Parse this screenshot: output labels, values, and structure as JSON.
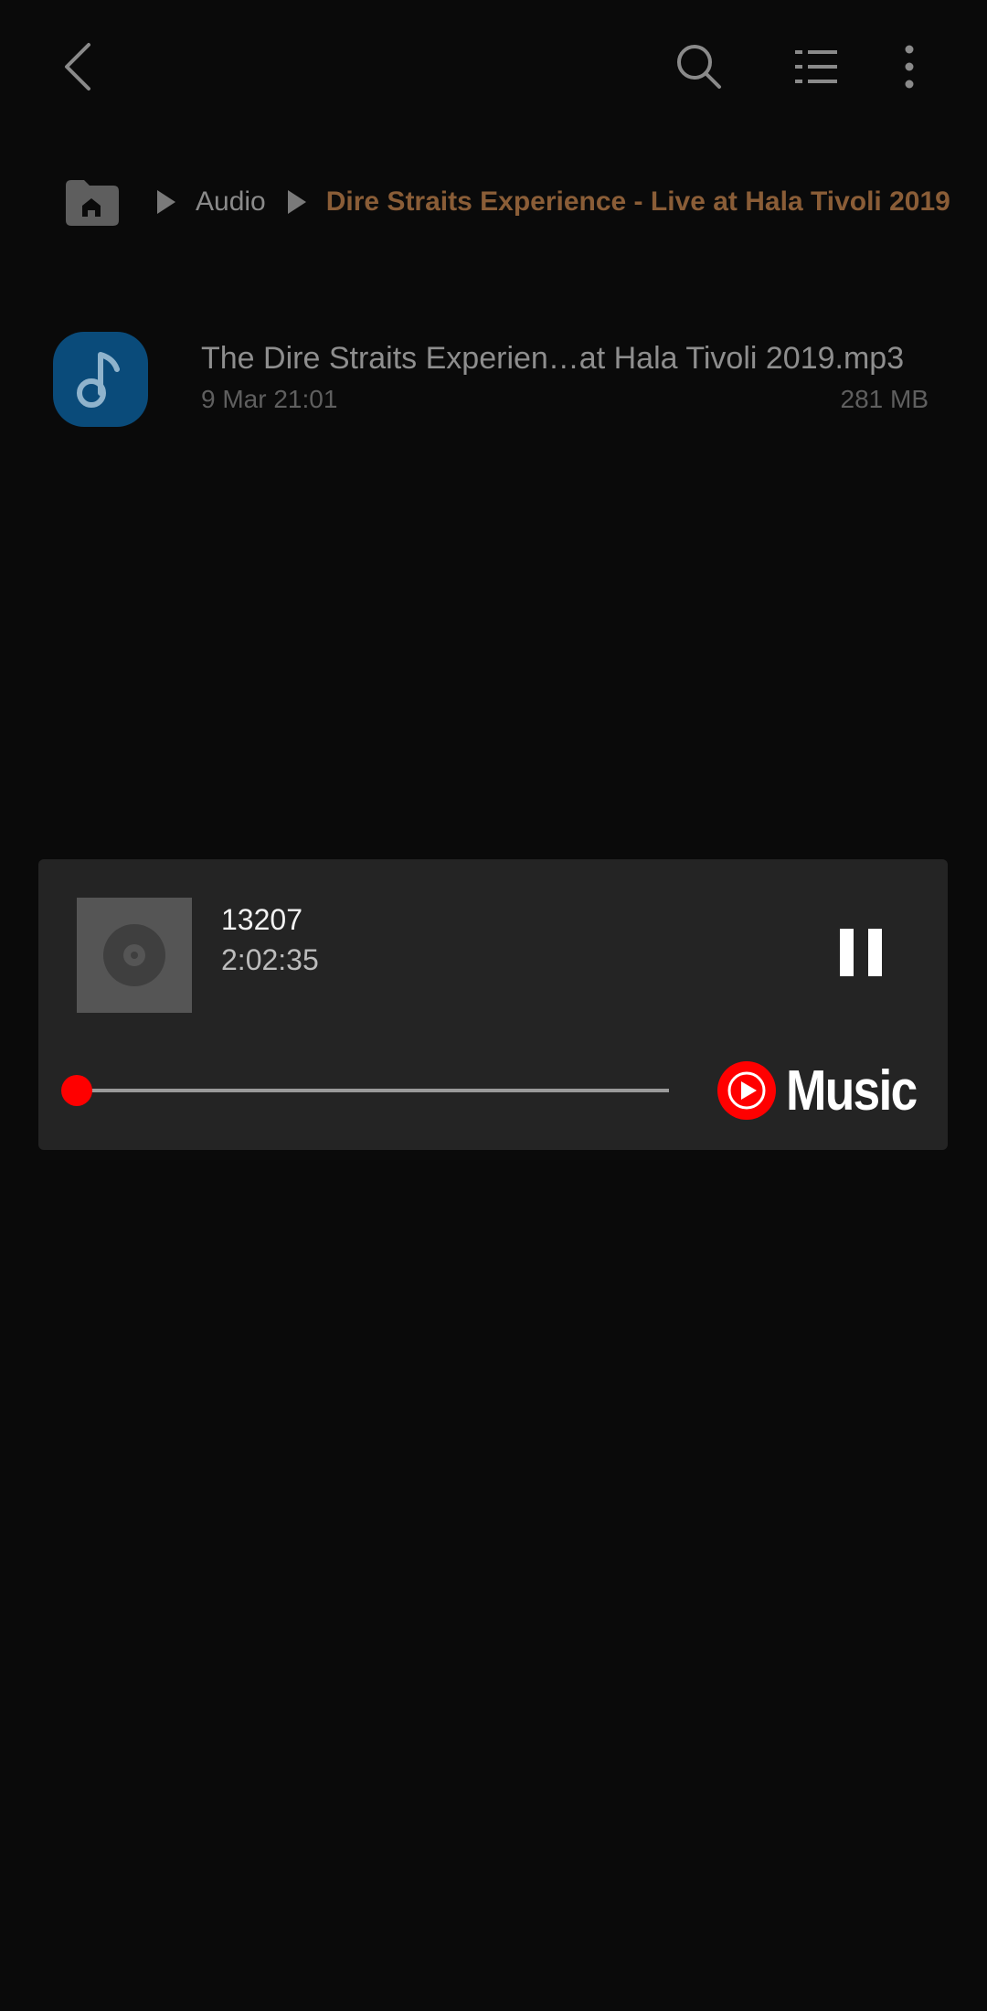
{
  "colors": {
    "background": "#0a0a0a",
    "breadcrumb_current": "#8a5d37",
    "file_icon_bg": "#0a4b7a",
    "player_bg": "#242424",
    "accent_red": "#ff0000"
  },
  "appbar": {
    "back_icon": "chevron-left-icon",
    "search_icon": "search-icon",
    "list_icon": "list-view-icon",
    "more_icon": "more-vertical-icon"
  },
  "breadcrumb": {
    "home_icon": "home-folder-icon",
    "items": [
      "Audio"
    ],
    "current": "Dire Straits Experience - Live at Hala Tivoli 2019"
  },
  "file": {
    "icon": "music-note-icon",
    "name": "The Dire Straits Experien…at Hala Tivoli 2019.mp3",
    "date": "9 Mar 21:01",
    "size": "281 MB"
  },
  "player": {
    "title": "13207",
    "duration": "2:02:35",
    "progress": 0,
    "pause_icon": "pause-icon",
    "logo_text": "Music"
  }
}
